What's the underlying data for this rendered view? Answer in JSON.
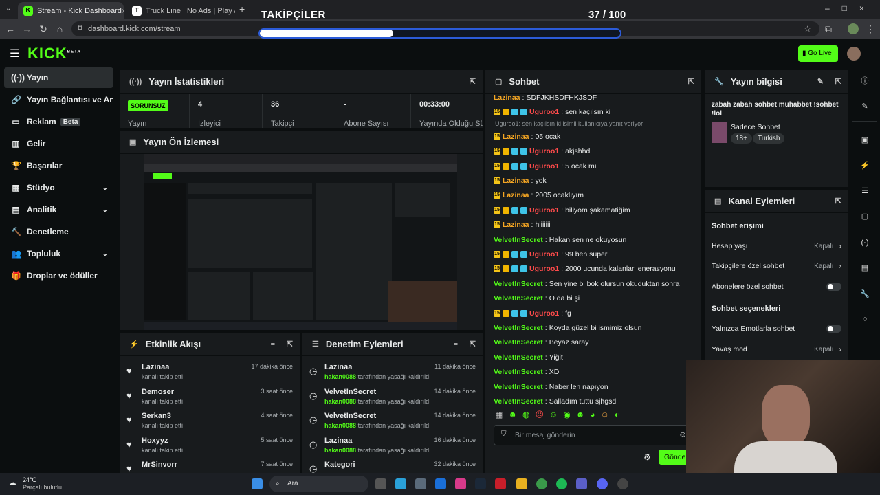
{
  "browser": {
    "tabs": [
      {
        "title": "Stream - Kick Dashboard"
      },
      {
        "title": "Truck Line | No Ads | Play At Fri"
      }
    ],
    "url": "dashboard.kick.com/stream"
  },
  "overlay": {
    "title": "TAKİPÇİLER",
    "count": "37 / 100",
    "progress": 0.37
  },
  "header": {
    "logo": "KICK",
    "logo_sup": "BETA",
    "golive": "Go Live"
  },
  "sidebar": {
    "items": [
      {
        "label": "Yayın",
        "icon": "broadcast-icon"
      },
      {
        "label": "Yayın Bağlantısı ve Anahtar",
        "icon": "link-icon"
      },
      {
        "label": "Reklam",
        "icon": "ad-icon",
        "badge": "Beta"
      },
      {
        "label": "Gelir",
        "icon": "revenue-icon"
      },
      {
        "label": "Başarılar",
        "icon": "trophy-icon"
      },
      {
        "label": "Stüdyo",
        "icon": "studio-icon"
      },
      {
        "label": "Analitik",
        "icon": "analytics-icon"
      },
      {
        "label": "Denetleme",
        "icon": "moderation-icon"
      },
      {
        "label": "Topluluk",
        "icon": "community-icon"
      },
      {
        "label": "Droplar ve ödüller",
        "icon": "drops-icon"
      }
    ]
  },
  "stats": {
    "title": "Yayın İstatistikleri",
    "items": [
      {
        "value": "SORUNSUZ",
        "label": "Yayın"
      },
      {
        "value": "4",
        "label": "İzleyici"
      },
      {
        "value": "36",
        "label": "Takipçi"
      },
      {
        "value": "-",
        "label": "Abone Sayısı"
      },
      {
        "value": "00:33:00",
        "label": "Yayında Olduğu Süre"
      }
    ]
  },
  "preview": {
    "title": "Yayın Ön İzlemesi"
  },
  "feed": {
    "title": "Etkinlik Akışı",
    "items": [
      {
        "name": "Lazinaa",
        "sub": "kanalı takip etti",
        "time": "17 dakika önce"
      },
      {
        "name": "Demoser",
        "sub": "kanalı takip etti",
        "time": "3 saat önce"
      },
      {
        "name": "Serkan3",
        "sub": "kanalı takip etti",
        "time": "4 saat önce"
      },
      {
        "name": "Hoxyyz",
        "sub": "kanalı takip etti",
        "time": "5 saat önce"
      },
      {
        "name": "MrSinvorr",
        "sub": "",
        "time": "7 saat önce"
      }
    ]
  },
  "modlog": {
    "title": "Denetim Eylemleri",
    "items": [
      {
        "name": "Lazinaa",
        "by": "hakan0088",
        "sub": "tarafından yasağı kaldırıldı",
        "time": "11 dakika önce"
      },
      {
        "name": "VelvetInSecret",
        "by": "hakan0088",
        "sub": "tarafından yasağı kaldırıldı",
        "time": "14 dakika önce"
      },
      {
        "name": "VelvetInSecret",
        "by": "hakan0088",
        "sub": "tarafından yasağı kaldırıldı",
        "time": "14 dakika önce"
      },
      {
        "name": "Lazinaa",
        "by": "hakan0088",
        "sub": "tarafından yasağı kaldırıldı",
        "time": "16 dakika önce"
      },
      {
        "name": "Kategori",
        "by": "",
        "sub": "",
        "time": "32 dakika önce"
      }
    ]
  },
  "chat": {
    "title": "Sohbet",
    "placeholder": "Bir mesaj gönderin",
    "send": "Gönder",
    "messages": [
      {
        "user": "Lazinaa",
        "color": "#f5a623",
        "text": "SDFJKHSDFHKJSDF",
        "badges": 0
      },
      {
        "user": "Uguroo1",
        "color": "#ff4b4b",
        "text": "sen kaçılsın ki",
        "badges": 3
      },
      {
        "reply": "Uguroo1: sen kaçılsın ki isimli kullanıcıya yanıt veriyor"
      },
      {
        "user": "Lazinaa",
        "color": "#f5a623",
        "text": "05 ocak",
        "badges": 1
      },
      {
        "user": "Uguroo1",
        "color": "#ff4b4b",
        "text": "akjshhd",
        "badges": 3
      },
      {
        "user": "Uguroo1",
        "color": "#ff4b4b",
        "text": "5 ocak mı",
        "badges": 3
      },
      {
        "user": "Lazinaa",
        "color": "#f5a623",
        "text": "yok",
        "badges": 1
      },
      {
        "user": "Lazinaa",
        "color": "#f5a623",
        "text": "2005 ocaklıyım",
        "badges": 1
      },
      {
        "user": "Uguroo1",
        "color": "#ff4b4b",
        "text": "biliyom şakamatiğim",
        "badges": 3
      },
      {
        "user": "Lazinaa",
        "color": "#f5a623",
        "text": "hiiiiiii",
        "badges": 1
      },
      {
        "user": "VelvetInSecret",
        "color": "#53fc18",
        "text": "Hakan sen ne okuyosun",
        "badges": 0
      },
      {
        "user": "Uguroo1",
        "color": "#ff4b4b",
        "text": "99 ben süper",
        "badges": 3
      },
      {
        "user": "Uguroo1",
        "color": "#ff4b4b",
        "text": "2000 ucunda kalanlar jenerasyonu",
        "badges": 3
      },
      {
        "user": "VelvetInSecret",
        "color": "#53fc18",
        "text": "Sen yine bi bok olursun okuduktan sonra",
        "badges": 0
      },
      {
        "user": "VelvetInSecret",
        "color": "#53fc18",
        "text": "O da bi şi",
        "badges": 0
      },
      {
        "user": "Uguroo1",
        "color": "#ff4b4b",
        "text": "fg",
        "badges": 3
      },
      {
        "user": "VelvetInSecret",
        "color": "#53fc18",
        "text": "Koyda güzel bi ismimiz olsun",
        "badges": 0
      },
      {
        "user": "VelvetInSecret",
        "color": "#53fc18",
        "text": "Beyaz saray",
        "badges": 0
      },
      {
        "user": "VelvetInSecret",
        "color": "#53fc18",
        "text": "Yiğit",
        "badges": 0
      },
      {
        "user": "VelvetInSecret",
        "color": "#53fc18",
        "text": "XD",
        "badges": 0
      },
      {
        "user": "VelvetInSecret",
        "color": "#53fc18",
        "text": "Naber len napıyon",
        "badges": 0
      },
      {
        "user": "VelvetInSecret",
        "color": "#53fc18",
        "text": "Salladım tuttu sjhgsd",
        "badges": 0
      }
    ]
  },
  "info": {
    "title": "Yayın bilgisi",
    "stream_title": "zabah zabah sohbet muhabbet !sohbet !lol",
    "category": "Sadece Sohbet",
    "tags": [
      "18+",
      "Turkish"
    ]
  },
  "actions": {
    "title": "Kanal Eylemleri",
    "sec1": "Sohbet erişimi",
    "sec2": "Sohbet seçenekleri",
    "rows1": [
      {
        "label": "Hesap yaşı",
        "val": "Kapalı"
      },
      {
        "label": "Takipçilere özel sohbet",
        "val": "Kapalı"
      },
      {
        "label": "Abonelere özel sohbet",
        "val": ""
      }
    ],
    "rows2": [
      {
        "label": "Yalnızca Emotlarla sohbet",
        "val": ""
      },
      {
        "label": "Yavaş mod",
        "val": "Kapalı"
      }
    ]
  },
  "taskbar": {
    "temp": "24°C",
    "weather": "Parçalı bulutlu",
    "search": "Ara"
  },
  "colors": {
    "accent": "#53fc18",
    "bg": "#0b0e0f",
    "panel": "#181b1d"
  }
}
